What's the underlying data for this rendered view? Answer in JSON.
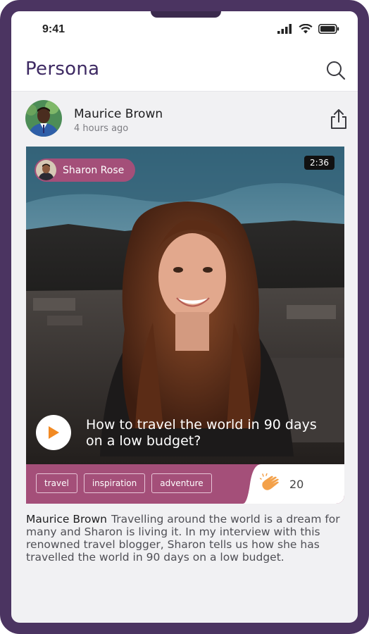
{
  "status_bar": {
    "time": "9:41"
  },
  "header": {
    "app_name": "Persona"
  },
  "post": {
    "author": "Maurice Brown",
    "time_ago": "4 hours ago",
    "video": {
      "guest_name": "Sharon Rose",
      "duration": "2:36",
      "title": "How to travel the world in 90 days on a low budget?"
    },
    "tags": [
      "travel",
      "inspiration",
      "adventure"
    ],
    "claps": "20",
    "description_author": "Maurice Brown",
    "description": "Travelling around the world is a dream for many and Sharon is living it. In my interview with this renowned travel blogger, Sharon tells us how she has travelled the world in 90 days on a low budget."
  },
  "colors": {
    "frame": "#4b3461",
    "brand": "#3e2a63",
    "accent": "#a44f79",
    "play_triangle": "#f28a23",
    "clap": "#f3a14a"
  },
  "icons": {
    "search": "search-icon",
    "share": "share-icon",
    "play": "play-icon",
    "clap": "clap-icon",
    "signal": "signal-icon",
    "wifi": "wifi-icon",
    "battery": "battery-icon"
  }
}
